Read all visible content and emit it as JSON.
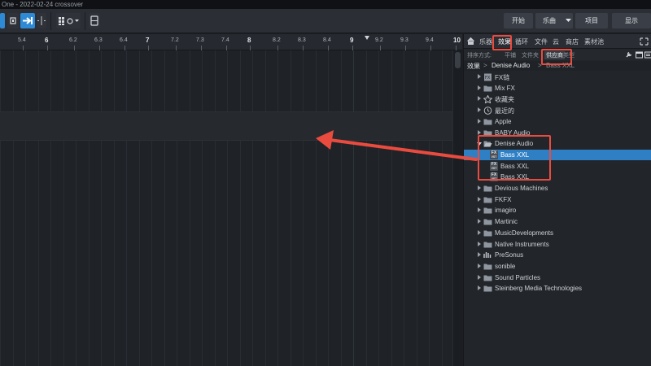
{
  "window": {
    "title": "One - 2022-02-24 crossover"
  },
  "toolbar": {
    "start_label": "开始",
    "song_label": "乐曲",
    "project_label": "项目",
    "show_label": "显示"
  },
  "ruler": {
    "labels": [
      "5.4",
      "6",
      "6.2",
      "6.3",
      "6.4",
      "7",
      "7.2",
      "7.3",
      "7.4",
      "8",
      "8.2",
      "8.3",
      "8.4",
      "9",
      "9.2",
      "9.3",
      "9.4",
      "10"
    ]
  },
  "browser": {
    "tabs": [
      "乐器",
      "效果",
      "循环",
      "文件",
      "云",
      "商店",
      "素材池"
    ],
    "active_tab": "效果",
    "sort_label": "排序方式:",
    "sort_options": [
      "平铺",
      "文件夹",
      "供应商",
      "类型"
    ],
    "active_sort": "供应商",
    "path": {
      "root": "效果",
      "separator": ">",
      "current": "Denise Audio",
      "sub": "Bass XXL"
    },
    "tree": [
      {
        "label": "FX链",
        "type": "chain",
        "expanded": false
      },
      {
        "label": "Mix FX",
        "type": "folder",
        "expanded": false
      },
      {
        "label": "收藏夹",
        "type": "star",
        "expanded": false
      },
      {
        "label": "最近的",
        "type": "clock",
        "expanded": false
      },
      {
        "label": "Apple",
        "type": "folder",
        "expanded": false
      },
      {
        "label": "BABY Audio",
        "type": "folder",
        "expanded": false
      },
      {
        "label": "Denise Audio",
        "type": "folder-open",
        "expanded": true
      },
      {
        "label": "Bass XXL",
        "type": "fx",
        "child": true,
        "selected": true
      },
      {
        "label": "Bass XXL",
        "type": "fx",
        "child": true
      },
      {
        "label": "Bass XXL",
        "type": "fx",
        "child": true
      },
      {
        "label": "Devious Machines",
        "type": "folder",
        "expanded": false
      },
      {
        "label": "FKFX",
        "type": "folder",
        "expanded": false
      },
      {
        "label": "imagiro",
        "type": "folder",
        "expanded": false
      },
      {
        "label": "Martinic",
        "type": "folder",
        "expanded": false
      },
      {
        "label": "MusicDevelopments",
        "type": "folder",
        "expanded": false
      },
      {
        "label": "Native Instruments",
        "type": "folder",
        "expanded": false
      },
      {
        "label": "PreSonus",
        "type": "presonus",
        "expanded": false
      },
      {
        "label": "sonible",
        "type": "folder",
        "expanded": false
      },
      {
        "label": "Sound Particles",
        "type": "folder",
        "expanded": false
      },
      {
        "label": "Steinberg Media Technologies",
        "type": "folder",
        "expanded": false
      }
    ],
    "fx_badge_top": "FX",
    "fx_badge_bottom": "VST"
  },
  "colors": {
    "accent": "#2f8ad6",
    "selection": "#2f7fc4",
    "annotation": "#ea4b3f",
    "folder": "#9aa0a8"
  }
}
